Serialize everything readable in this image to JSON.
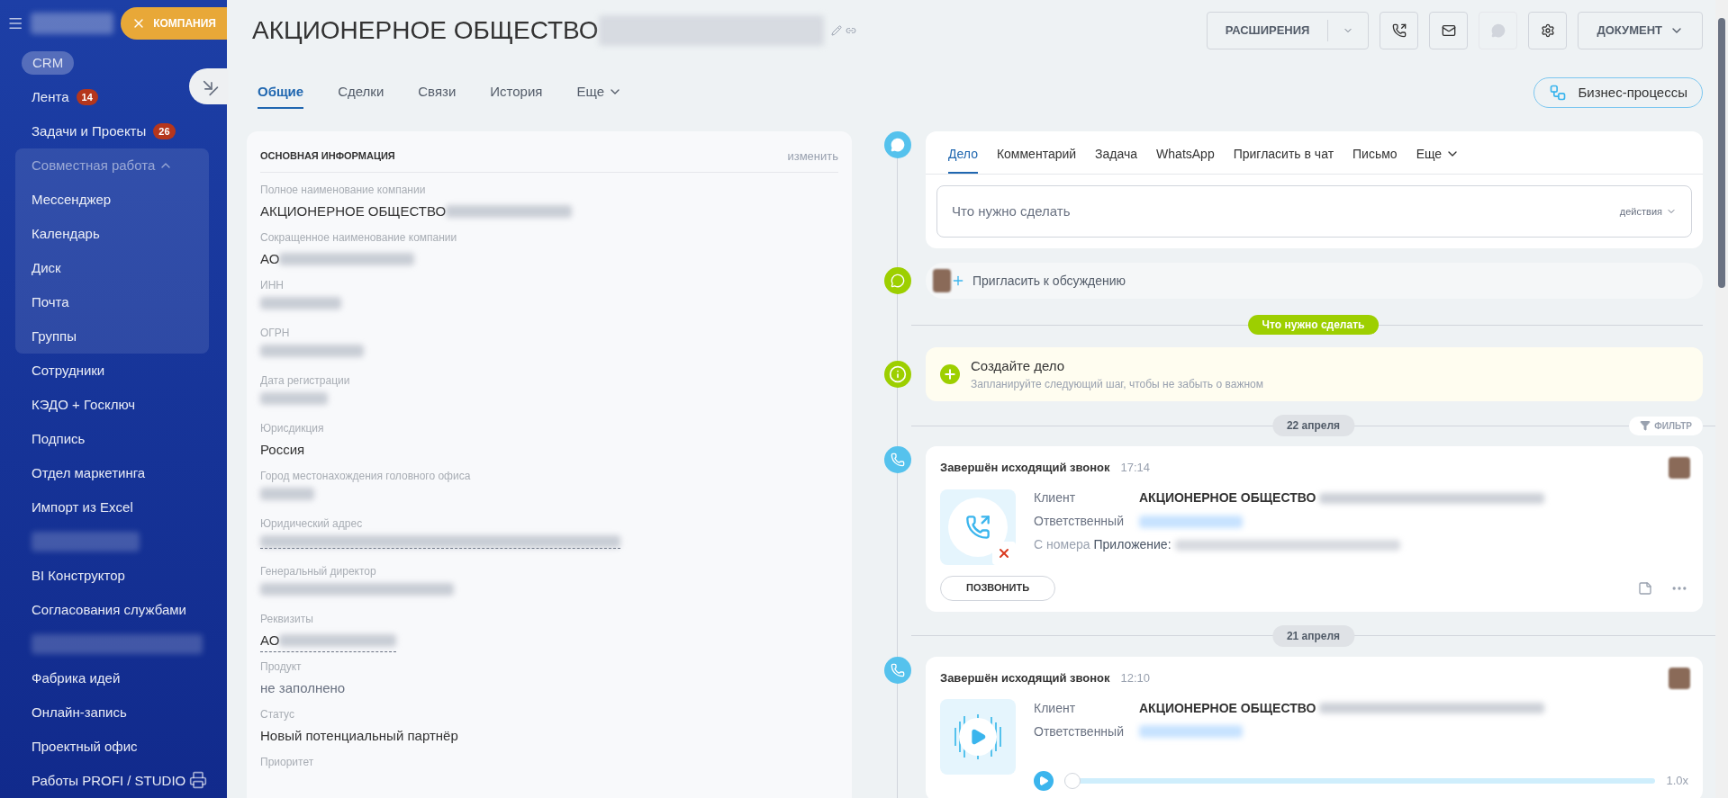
{
  "sidebar": {
    "company_chip": {
      "label": "КОМПАНИЯ"
    },
    "items": [
      {
        "kind": "section",
        "label": "CRM"
      },
      {
        "kind": "item",
        "label": "Лента",
        "counter": "14"
      },
      {
        "kind": "item",
        "label": "Задачи и Проекты",
        "counter": "26"
      },
      {
        "kind": "group",
        "label": "Совместная работа",
        "expanded": true,
        "children": [
          {
            "label": "Мессенджер"
          },
          {
            "label": "Календарь"
          },
          {
            "label": "Диск"
          },
          {
            "label": "Почта"
          },
          {
            "label": "Группы"
          }
        ]
      },
      {
        "kind": "item",
        "label": "Сотрудники"
      },
      {
        "kind": "item",
        "label": "КЭДО + Госключ"
      },
      {
        "kind": "item",
        "label": "Подпись"
      },
      {
        "kind": "item",
        "label": "Отдел маркетинга"
      },
      {
        "kind": "item",
        "label": "Импорт из Excel"
      },
      {
        "kind": "redacted"
      },
      {
        "kind": "item",
        "label": "BI Конструктор"
      },
      {
        "kind": "item",
        "label": "Согласования службами"
      },
      {
        "kind": "redacted"
      },
      {
        "kind": "item",
        "label": "Фабрика идей"
      },
      {
        "kind": "item",
        "label": "Онлайн-запись"
      },
      {
        "kind": "item",
        "label": "Проектный офис"
      },
      {
        "kind": "item",
        "label": "Работы PROFI / STUDIO"
      }
    ]
  },
  "header": {
    "title": "АКЦИОНЕРНОЕ ОБЩЕСТВО",
    "title_redacted": true,
    "buttons": {
      "extensions": "РАСШИРЕНИЯ",
      "document": "ДОКУМЕНТ"
    },
    "tabs": [
      {
        "label": "Общие",
        "selected": true
      },
      {
        "label": "Сделки",
        "selected": false
      },
      {
        "label": "Связи",
        "selected": false
      },
      {
        "label": "История",
        "selected": false
      },
      {
        "label": "Еще",
        "selected": false
      }
    ],
    "business_processes": "Бизнес-процессы"
  },
  "info_card": {
    "title": "ОСНОВНАЯ ИНФОРМАЦИЯ",
    "edit": "изменить",
    "fields": [
      {
        "label": "Полное наименование компании",
        "value": "АКЦИОНЕРНОЕ ОБЩЕСТВО",
        "redacted": true,
        "linked": false
      },
      {
        "label": "Сокращенное наименование компании",
        "value": "АО",
        "redacted": true,
        "linked": false
      },
      {
        "label": "ИНН",
        "redacted": true,
        "linked": false
      },
      {
        "label": "ОГРН",
        "redacted": true,
        "linked": false
      },
      {
        "label": "Дата регистрации",
        "redacted": true,
        "linked": false
      },
      {
        "label": "Юрисдикция",
        "value": "Россия",
        "redacted": false,
        "linked": false,
        "empty": false
      },
      {
        "label": "Город местонахождения головного офиса",
        "redacted": true,
        "linked": false
      },
      {
        "label": "Юридический адрес",
        "redacted": true,
        "linked": true
      },
      {
        "label": "Генеральный директор",
        "redacted": true,
        "linked": false
      },
      {
        "label": "Реквизиты",
        "value": "АО",
        "redacted": true,
        "linked": true,
        "empty": false
      },
      {
        "label": "Продукт",
        "value": "не заполнено",
        "redacted": false,
        "linked": false,
        "empty": true
      },
      {
        "label": "Статус",
        "value": "Новый потенциальный партнёр",
        "redacted": false,
        "linked": false,
        "empty": false
      },
      {
        "label": "Приоритет"
      }
    ]
  },
  "timeline": {
    "composer": {
      "tabs": [
        {
          "label": "Дело",
          "selected": true
        },
        {
          "label": "Комментарий",
          "selected": false
        },
        {
          "label": "Задача",
          "selected": false
        },
        {
          "label": "WhatsApp",
          "selected": false
        },
        {
          "label": "Пригласить в чат",
          "selected": false
        },
        {
          "label": "Письмо",
          "selected": false
        },
        {
          "label": "Еще",
          "selected": false
        }
      ],
      "placeholder": "Что нужно сделать",
      "actions": "действия"
    },
    "invite": "Пригласить к обсуждению",
    "todo_divider": "Что нужно сделать",
    "create_card": {
      "title": "Создайте дело",
      "subtitle": "Запланируйте следующий шаг, чтобы не забыть о важном"
    },
    "filter": "ФИЛЬТР",
    "entries": [
      {
        "date": "22 апреля",
        "kind": "missed_call",
        "title": "Завершён исходящий звонок",
        "time": "17:14",
        "client_label": "Клиент",
        "client": "АКЦИОНЕРНОЕ ОБЩЕСТВО",
        "responsible_label": "Ответственный",
        "from_label": "С номера",
        "from": "Приложение:",
        "button": "ПОЗВОНИТЬ"
      },
      {
        "date": "21 апреля",
        "kind": "recording",
        "title": "Завершён исходящий звонок",
        "time": "12:10",
        "client_label": "Клиент",
        "client": "АКЦИОНЕРНОЕ ОБЩЕСТВО",
        "responsible_label": "Ответственный",
        "level": 0,
        "speed": "1.0x"
      }
    ]
  }
}
